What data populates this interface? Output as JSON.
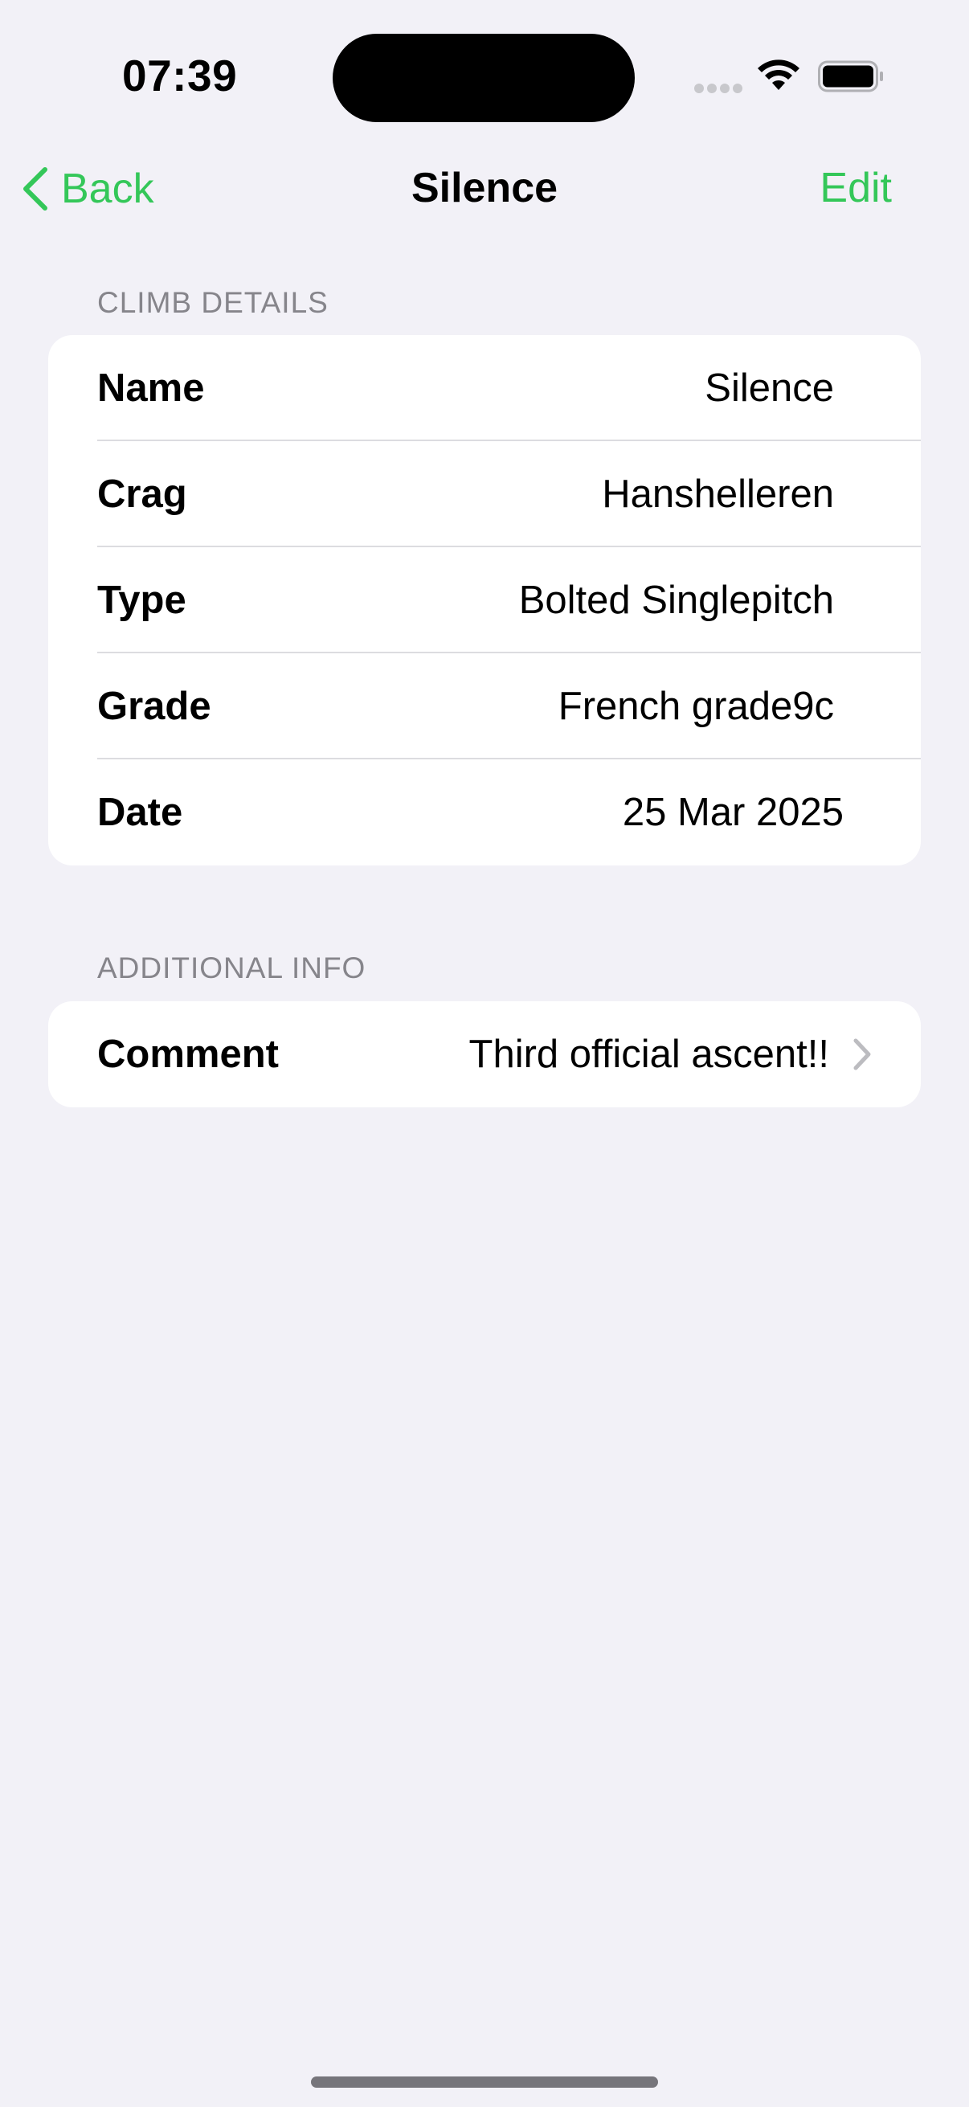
{
  "status_bar": {
    "time": "07:39"
  },
  "nav": {
    "back_label": "Back",
    "title": "Silence",
    "edit_label": "Edit"
  },
  "sections": {
    "climb_details": {
      "header": "CLIMB DETAILS",
      "rows": [
        {
          "label": "Name",
          "value": "Silence"
        },
        {
          "label": "Crag",
          "value": "Hanshelleren"
        },
        {
          "label": "Type",
          "value": "Bolted Singlepitch"
        },
        {
          "label": "Grade",
          "value": "French grade9c"
        },
        {
          "label": "Date",
          "value": "25 Mar 2025"
        }
      ]
    },
    "additional_info": {
      "header": "ADDITIONAL INFO",
      "comment": {
        "label": "Comment",
        "value": "Third official ascent!!"
      }
    }
  },
  "colors": {
    "accent": "#34c759",
    "background": "#f2f1f7",
    "card": "#ffffff",
    "secondary_text": "#86858b"
  },
  "icons": [
    "back-chevron-icon",
    "wifi-icon",
    "battery-icon",
    "cellular-signal-icon",
    "disclosure-chevron-icon"
  ]
}
